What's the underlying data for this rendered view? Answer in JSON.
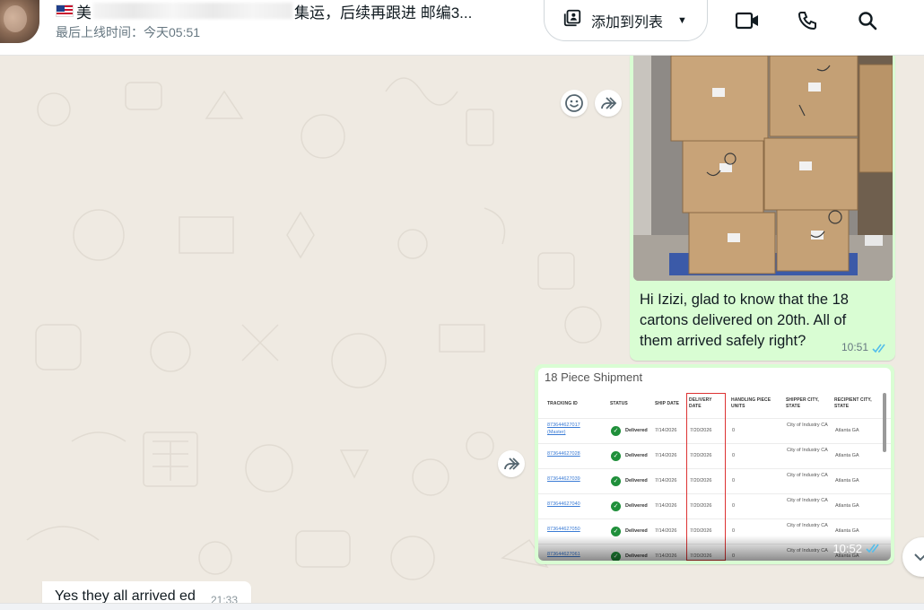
{
  "header": {
    "title_start": "美",
    "title_end": "集运，后续再跟进 邮编3...",
    "last_seen": "最后上线时间：今天05:51",
    "add_to_list_label": "添加到列表"
  },
  "messages": {
    "photo_message": {
      "text": "Hi Izizi, glad to know that the 18 cartons delivered on 20th. All of them arrived safely right?",
      "time": "10:51"
    },
    "table_message": {
      "time": "10:52",
      "screenshot": {
        "title": "18 Piece Shipment",
        "columns": [
          "TRACKING ID",
          "STATUS",
          "SHIP DATE",
          "DELIVERY DATE",
          "HANDLING PIECE UNITS",
          "SHIPPER CITY, STATE",
          "RECIPIENT CITY, STATE"
        ],
        "rows": [
          {
            "tracking": "873644627017",
            "sub": "(Master)",
            "status": "Delivered",
            "ship": "7/14/2026",
            "delivery": "7/20/2026",
            "units": "0",
            "shipper": "City of Industry CA",
            "recipient": "Atlanta GA"
          },
          {
            "tracking": "873644627028",
            "sub": "",
            "status": "Delivered",
            "ship": "7/14/2026",
            "delivery": "7/20/2026",
            "units": "0",
            "shipper": "City of Industry CA",
            "recipient": "Atlanta GA"
          },
          {
            "tracking": "873644627039",
            "sub": "",
            "status": "Delivered",
            "ship": "7/14/2026",
            "delivery": "7/20/2026",
            "units": "0",
            "shipper": "City of Industry CA",
            "recipient": "Atlanta GA"
          },
          {
            "tracking": "873644627040",
            "sub": "",
            "status": "Delivered",
            "ship": "7/14/2026",
            "delivery": "7/20/2026",
            "units": "0",
            "shipper": "City of Industry CA",
            "recipient": "Atlanta GA"
          },
          {
            "tracking": "873644627050",
            "sub": "",
            "status": "Delivered",
            "ship": "7/14/2026",
            "delivery": "7/20/2026",
            "units": "0",
            "shipper": "City of Industry CA",
            "recipient": "Atlanta GA"
          },
          {
            "tracking": "873644627061",
            "sub": "",
            "status": "Delivered",
            "ship": "7/14/2026",
            "delivery": "7/20/2026",
            "units": "0",
            "shipper": "City of Industry CA",
            "recipient": "Atlanta GA"
          }
        ]
      }
    },
    "incoming_message": {
      "text": "Yes they all arrived ed",
      "time": "21:33"
    }
  },
  "colors": {
    "outgoing_bubble": "#d9fdd3",
    "incoming_bubble": "#ffffff",
    "chat_background": "#efeae2",
    "read_ticks": "#53bdeb",
    "delivered_check": "#1f8f3a"
  },
  "icons": [
    "add-to-list-icon",
    "video-call-icon",
    "voice-call-icon",
    "search-icon",
    "emoji-icon",
    "forward-icon",
    "scroll-down-icon"
  ]
}
